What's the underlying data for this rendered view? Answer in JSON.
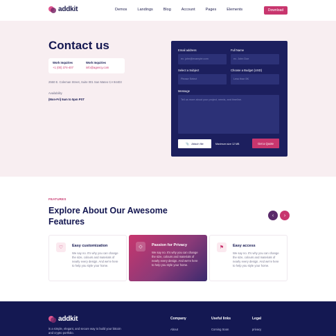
{
  "nav": {
    "brand": "addkit",
    "menu": [
      "Demos",
      "Landings",
      "Blog",
      "Account",
      "Pages",
      "Elements"
    ],
    "download": "Download"
  },
  "contact": {
    "title": "Contact us",
    "inquiries": [
      {
        "heading": "Work Inquiries",
        "value": "+1 (00) 374-407"
      },
      {
        "heading": "Work Inquiries",
        "value": "info@agency.com"
      }
    ],
    "address": "2550 E. Coleman Street, Suite 001 San Mateo CA 94403",
    "availability": "Availability",
    "hours": "(Mon-Fri) 9am to 5pm PST"
  },
  "form": {
    "email_label": "Email address",
    "email_placeholder": "ex. john@example.com",
    "name_label": "Full Name",
    "name_placeholder": "ex. John Doe",
    "subject_label": "Select a Subject",
    "subject_placeholder": "Please Select",
    "budget_label": "Choose a Budget (USD)",
    "budget_placeholder": "Less than 5K",
    "message_label": "Message",
    "message_placeholder": "Tell us more about your project, needs, and timeline.",
    "attach": "Attach file",
    "max_size": "Maximum size 12 MB",
    "submit": "Get a Quote"
  },
  "features": {
    "tag": "FEATURES",
    "title": "Explore About Our Awesome Features",
    "prev_icon": "chevron-left-icon",
    "next_icon": "chevron-right-icon",
    "cards": [
      {
        "title": "Easy customization",
        "desc": "We say no. It's why you can change the size, colours and materials of nearly every design. And we're here to help you style your home.",
        "icon": "heart-icon"
      },
      {
        "title": "Passion for Privacy",
        "desc": "We say no. It's why you can change the size, colours and materials of nearly every design. And we're here to help you style your home.",
        "icon": "diamond-icon"
      },
      {
        "title": "Easy access",
        "desc": "We say no. It's why you can change the size, colours and materials of nearly every design. And we're here to help you style your home.",
        "icon": "signpost-icon"
      }
    ]
  },
  "footer": {
    "brand": "addkit",
    "desc": "is a simple, elegant, and secure way to build your bitcoin and crypto portfolio.",
    "columns": [
      {
        "heading": "Company",
        "first_item": "About"
      },
      {
        "heading": "Useful links",
        "first_item": "Coming Soon"
      },
      {
        "heading": "Legal",
        "first_item": "privacy"
      }
    ]
  },
  "colors": {
    "accent": "#c8366e",
    "navy": "#1c1f5e",
    "hero_bg": "#f8eef1"
  }
}
